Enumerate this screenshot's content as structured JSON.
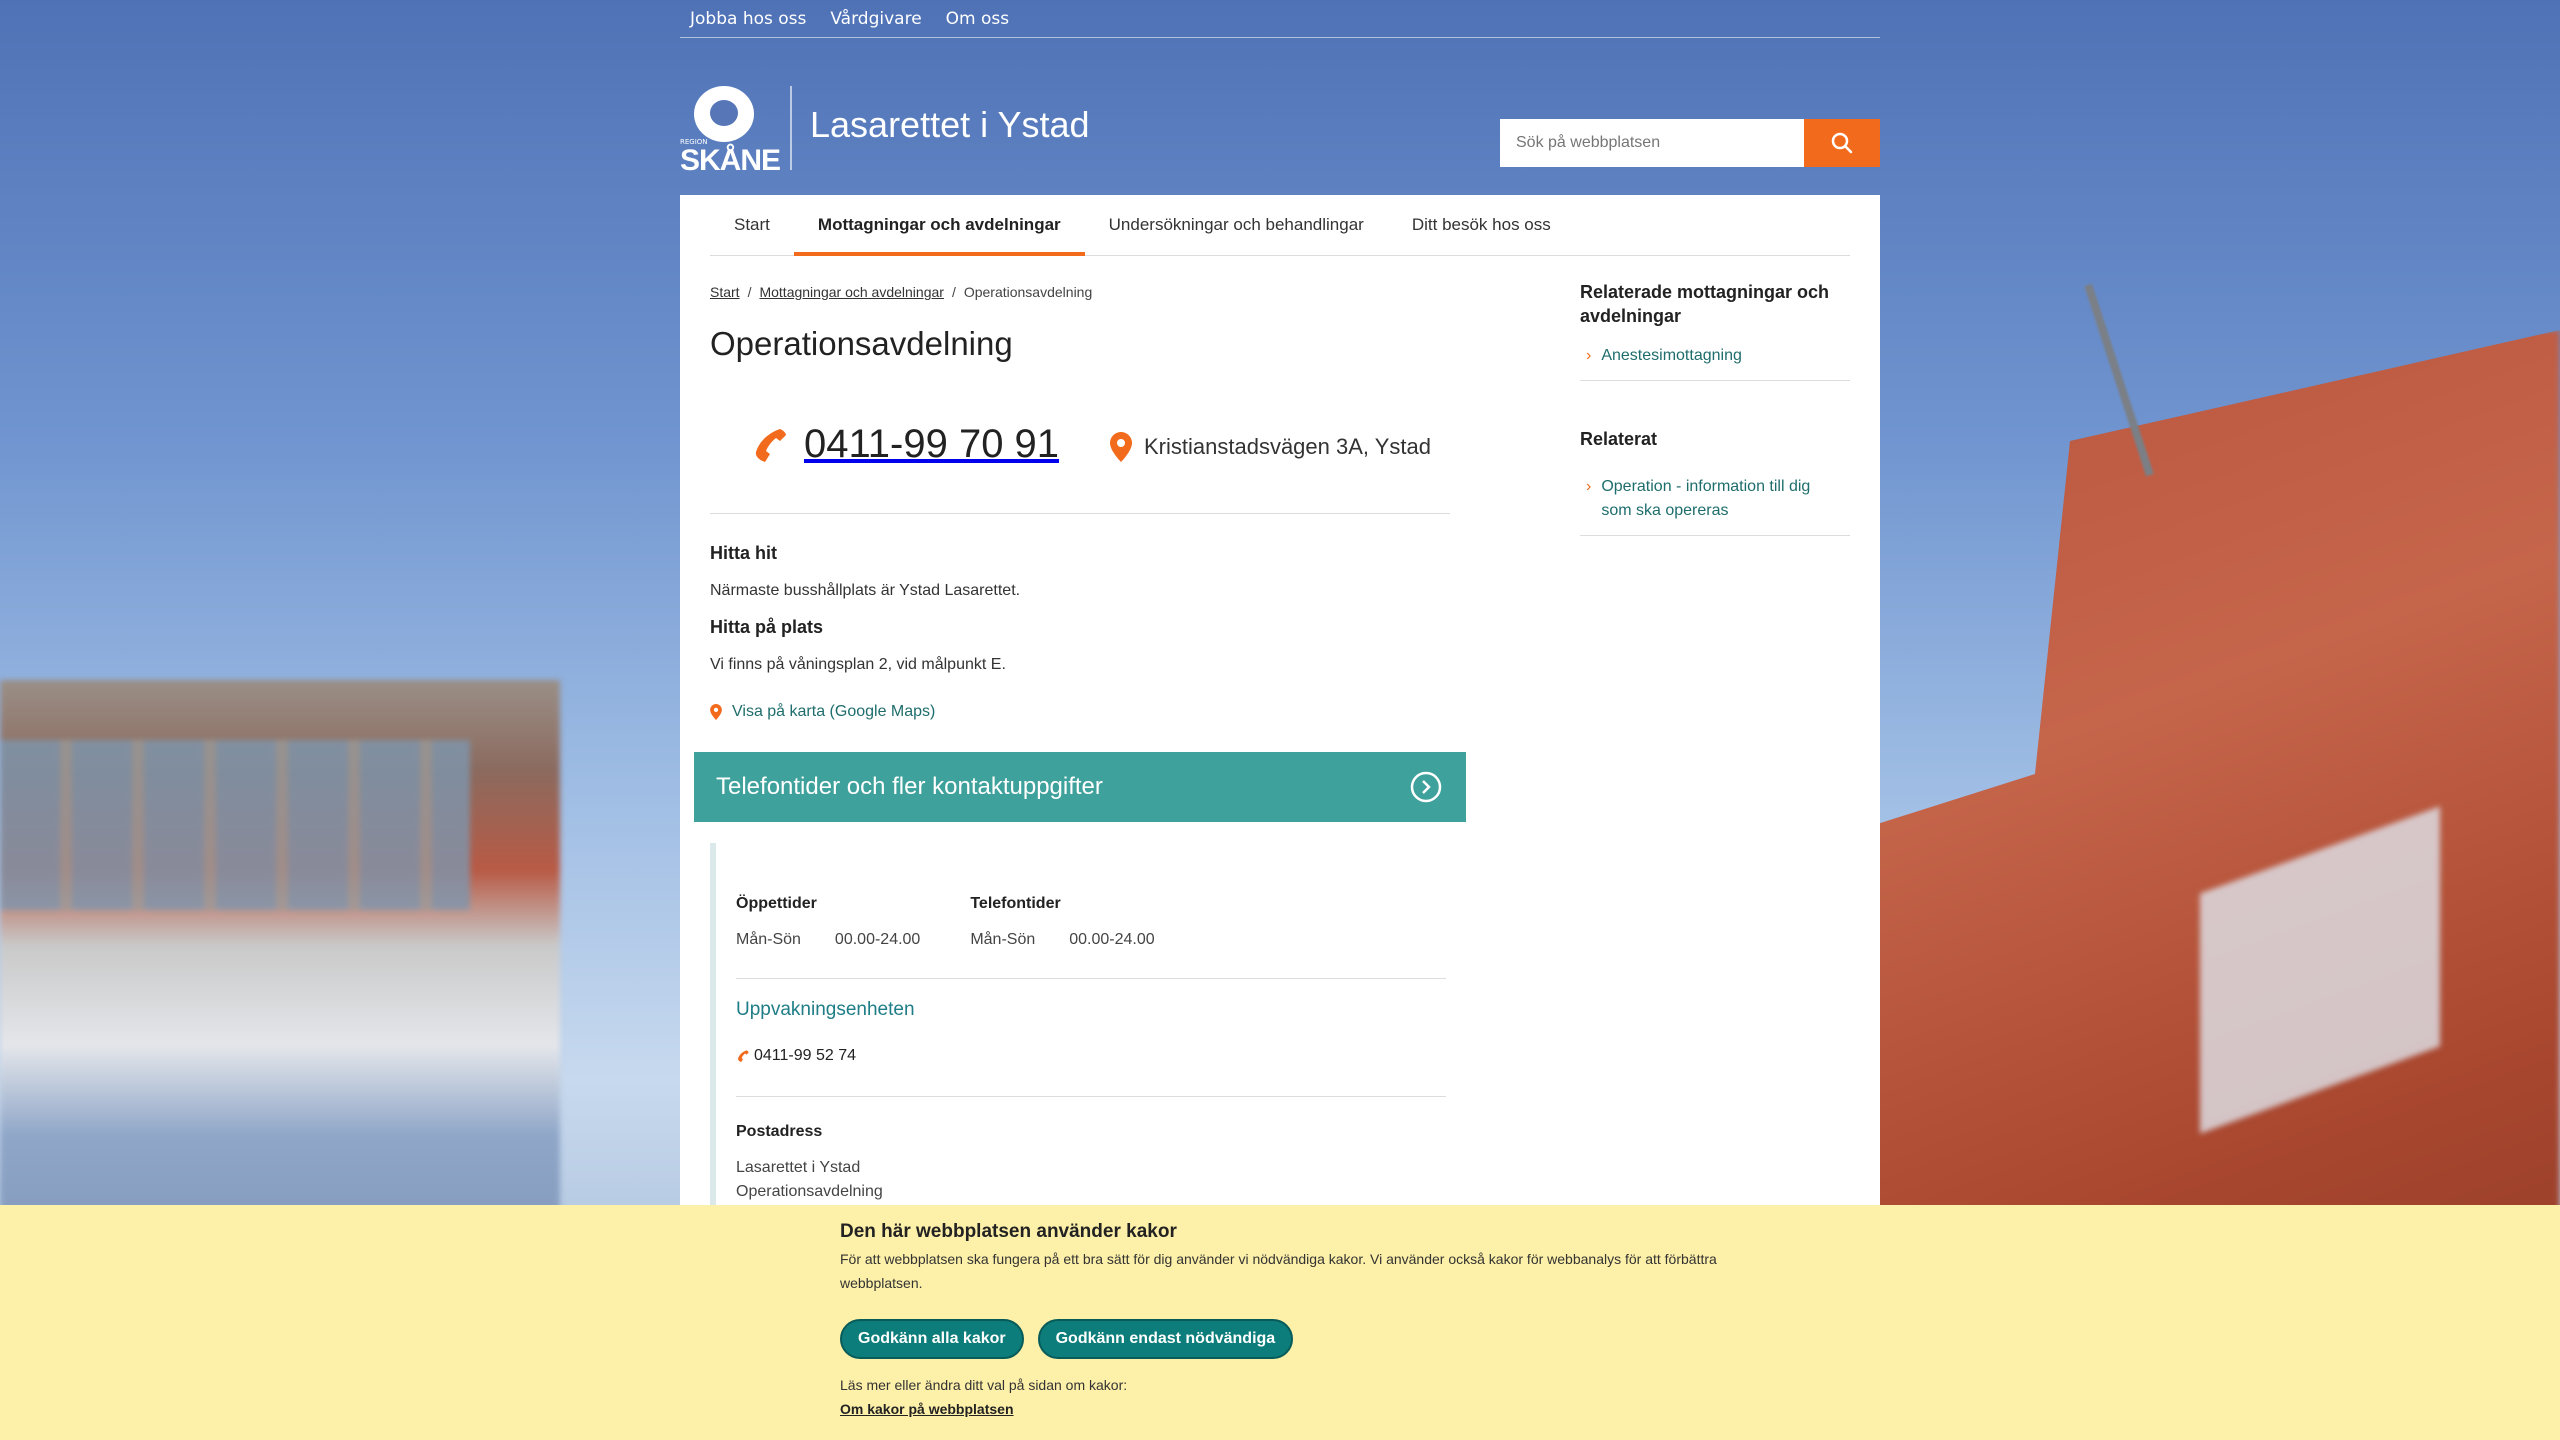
{
  "topnav": {
    "items": [
      "Jobba hos oss",
      "Vårdgivare",
      "Om oss"
    ]
  },
  "header": {
    "logo_small": "REGION",
    "logo_text": "SKÅNE",
    "site_title": "Lasarettet i Ystad",
    "search_placeholder": "Sök på webbplatsen"
  },
  "mainnav": {
    "items": [
      "Start",
      "Mottagningar och avdelningar",
      "Undersökningar och behandlingar",
      "Ditt besök hos oss"
    ],
    "active": "Mottagningar och avdelningar"
  },
  "breadcrumb": {
    "items": [
      "Start",
      "Mottagningar och avdelningar",
      "Operationsavdelning"
    ],
    "sep": "/"
  },
  "page": {
    "title": "Operationsavdelning",
    "phone": "0411-99 70 91",
    "address": "Kristianstadsvägen 3A, Ystad",
    "find_heading": "Hitta hit",
    "find_text": "Närmaste busshållplats är Ystad Lasarettet.",
    "onsite_heading": "Hitta på plats",
    "onsite_text": "Vi finns på våningsplan 2, vid målpunkt E.",
    "map_link": "Visa på karta (Google Maps)"
  },
  "accordion": {
    "title": "Telefontider och fler kontaktuppgifter",
    "opening_label": "Öppettider",
    "opening_days": "Mån-Sön",
    "opening_hours": "00.00-24.00",
    "phone_label": "Telefontider",
    "phone_days": "Mån-Sön",
    "phone_hours": "00.00-24.00",
    "unit_name": "Uppvakningsenheten",
    "unit_phone": "0411-99 52 74",
    "postal_label": "Postadress",
    "postal_line1": "Lasarettet i Ystad",
    "postal_line2": "Operationsavdelning"
  },
  "sidebar": {
    "related_units_heading": "Relaterade mottagningar och avdelningar",
    "related_units": [
      "Anestesimottagning"
    ],
    "related_heading": "Relaterat",
    "related": [
      "Operation - information till dig som ska opereras"
    ]
  },
  "cookie": {
    "title": "Den här webbplatsen använder kakor",
    "text": "För att webbplatsen ska fungera på ett bra sätt för dig använder vi nödvändiga kakor. Vi använder också kakor för webbanalys för att förbättra webbplatsen.",
    "accept_all": "Godkänn alla kakor",
    "accept_necessary": "Godkänn endast nödvändiga",
    "more_text": "Läs mer eller ändra ditt val på sidan om kakor:",
    "more_link": "Om kakor på webbplatsen"
  },
  "colors": {
    "accent": "#f26b1d",
    "teal": "#3ea19b",
    "button": "#0c7d7a",
    "cookie_bg": "#fdf0a8"
  }
}
